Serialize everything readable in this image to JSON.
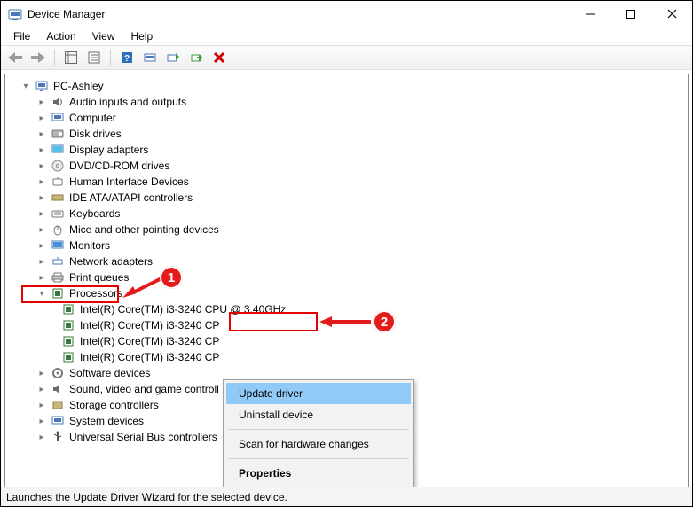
{
  "window": {
    "title": "Device Manager"
  },
  "menu": [
    "File",
    "Action",
    "View",
    "Help"
  ],
  "tree": {
    "root": "PC-Ashley",
    "categories": [
      "Audio inputs and outputs",
      "Computer",
      "Disk drives",
      "Display adapters",
      "DVD/CD-ROM drives",
      "Human Interface Devices",
      "IDE ATA/ATAPI controllers",
      "Keyboards",
      "Mice and other pointing devices",
      "Monitors",
      "Network adapters",
      "Print queues",
      "Processors",
      "Software devices",
      "Sound, video and game controll",
      "Storage controllers",
      "System devices",
      "Universal Serial Bus controllers"
    ],
    "processors_children_full": "Intel(R) Core(TM) i3-3240 CPU @ 3.40GHz",
    "processors_children_cut": "Intel(R) Core(TM) i3-3240 CP"
  },
  "context_menu": {
    "update": "Update driver",
    "uninstall": "Uninstall device",
    "scan": "Scan for hardware changes",
    "properties": "Properties"
  },
  "callouts": {
    "one": "1",
    "two": "2"
  },
  "status": "Launches the Update Driver Wizard for the selected device."
}
